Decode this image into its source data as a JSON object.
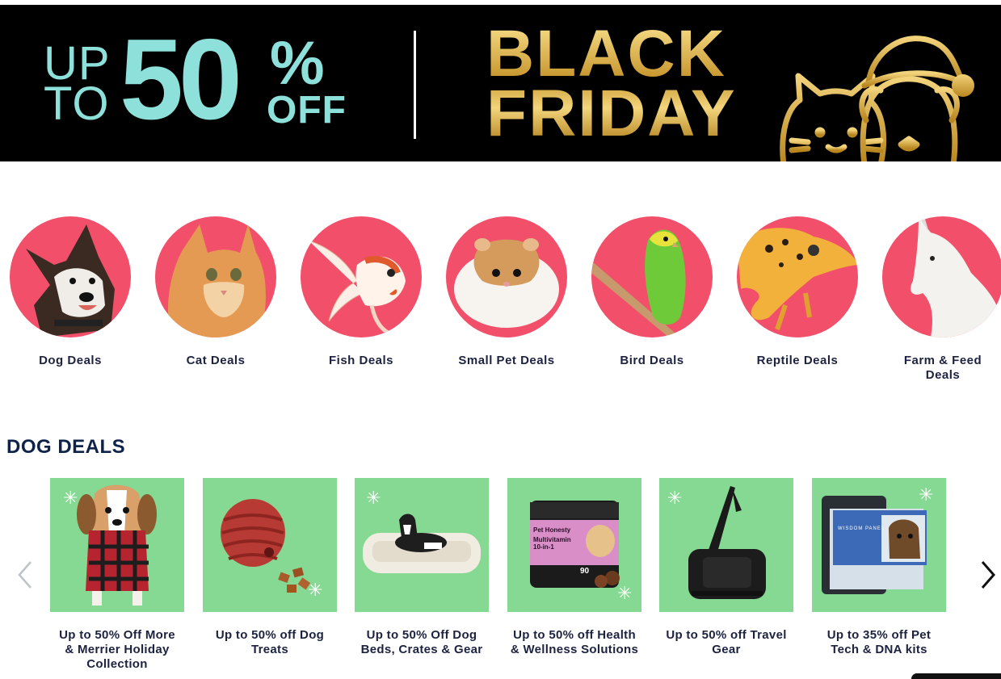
{
  "banner": {
    "up": "UP",
    "to": "TO",
    "fifty": "50",
    "percent": "%",
    "off": "OFF",
    "black": "BLACK",
    "friday": "FRIDAY",
    "accent_color": "#8ee0db",
    "gold_color": "#d4a63a"
  },
  "categories": [
    {
      "label": "Dog Deals",
      "icon": "dog"
    },
    {
      "label": "Cat Deals",
      "icon": "cat"
    },
    {
      "label": "Fish Deals",
      "icon": "fish"
    },
    {
      "label": "Small Pet Deals",
      "icon": "hamster"
    },
    {
      "label": "Bird Deals",
      "icon": "parakeet"
    },
    {
      "label": "Reptile Deals",
      "icon": "gecko"
    },
    {
      "label": "Farm & Feed",
      "label2": "Deals",
      "icon": "horse"
    }
  ],
  "dog_deals": {
    "title": "DOG DEALS",
    "cards": [
      {
        "line1": "Up to 50% Off More",
        "line2": "& Merrier Holiday",
        "line3": "Collection"
      },
      {
        "line1": "Up to 50% off Dog",
        "line2": "Treats"
      },
      {
        "line1": "Up to 50% Off Dog",
        "line2": "Beds, Crates & Gear"
      },
      {
        "line1": "Up to 50% off Health",
        "line2": "& Wellness Solutions"
      },
      {
        "line1": "Up to 50% off Travel",
        "line2": "Gear"
      },
      {
        "line1": "Up to 35% off Pet",
        "line2": "Tech & DNA kits"
      }
    ],
    "product_text": {
      "brand": "Pet Honesty",
      "product_name": "Multivitamin 10-in-1",
      "count": "90",
      "kit_brand": "WISDOM PANEL"
    }
  },
  "colors": {
    "circle_bg": "#f2506a",
    "tile_bg": "#86d992",
    "title_color": "#0f2249"
  }
}
